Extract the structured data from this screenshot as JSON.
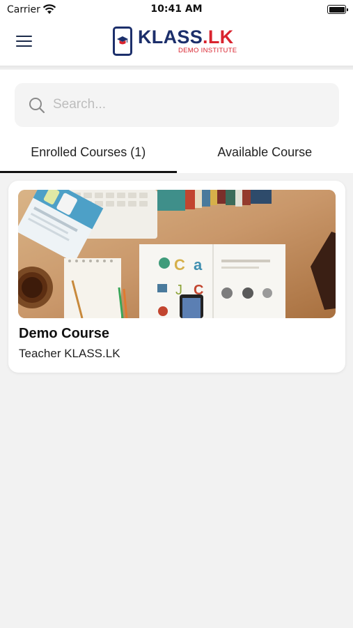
{
  "status_bar": {
    "carrier": "Carrier",
    "time": "10:41 AM"
  },
  "header": {
    "logo_text_main": "KLASS",
    "logo_text_dot": ".",
    "logo_text_suffix": "LK",
    "logo_subtitle": "DEMO INSTITUTE",
    "brand_colors": {
      "navy": "#1c2f6b",
      "red": "#d9232e"
    }
  },
  "search": {
    "placeholder": "Search...",
    "value": ""
  },
  "tabs": [
    {
      "label": "Enrolled Courses (1)",
      "active": true
    },
    {
      "label": "Available Course",
      "active": false
    }
  ],
  "courses": [
    {
      "title": "Demo Course",
      "teacher": "Teacher KLASS.LK"
    }
  ]
}
